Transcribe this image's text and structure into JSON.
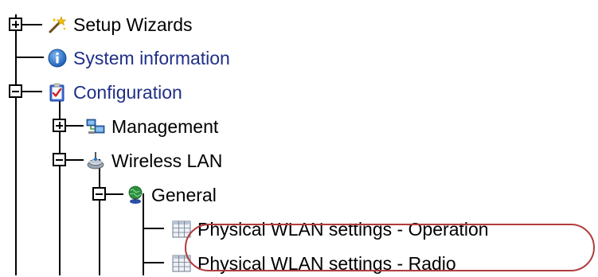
{
  "tree": {
    "nodes": [
      {
        "id": "setup-wizards",
        "label": "Setup Wizards",
        "icon": "wand-icon",
        "expanded": false
      },
      {
        "id": "system-information",
        "label": "System information",
        "icon": "info-icon",
        "expanded": null
      },
      {
        "id": "configuration",
        "label": "Configuration",
        "icon": "clipboard-check-icon",
        "expanded": true
      },
      {
        "id": "management",
        "label": "Management",
        "icon": "network-computers-icon",
        "expanded": false
      },
      {
        "id": "wireless-lan",
        "label": "Wireless LAN",
        "icon": "antenna-icon",
        "expanded": true
      },
      {
        "id": "general",
        "label": "General",
        "icon": "globe-user-icon",
        "expanded": true
      },
      {
        "id": "wlan-operation",
        "label": "Physical WLAN settings - Operation",
        "icon": "table-icon",
        "expanded": null
      },
      {
        "id": "wlan-radio",
        "label": "Physical WLAN settings - Radio",
        "icon": "table-icon",
        "expanded": null,
        "highlighted": true
      }
    ]
  },
  "colors": {
    "link_blue": "#1f2f88",
    "highlight_border": "#b23b3b"
  }
}
